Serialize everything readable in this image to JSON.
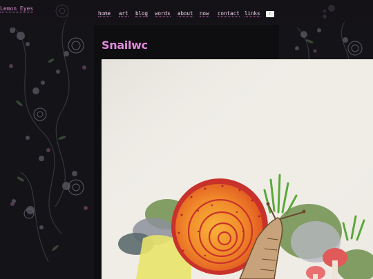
{
  "site": {
    "title": "Lemon Eyes"
  },
  "nav": {
    "items": [
      {
        "label": "home"
      },
      {
        "label": "art"
      },
      {
        "label": "blog"
      },
      {
        "label": "words"
      },
      {
        "label": "about"
      },
      {
        "label": "now"
      },
      {
        "label": "contact"
      },
      {
        "label": "links"
      }
    ],
    "theme_toggle_icon": "moon-icon"
  },
  "page": {
    "title": "Snailwc"
  },
  "artwork": {
    "subject": "watercolor snail with mushrooms and mossy rocks",
    "colors": {
      "paper": "#f1efe9",
      "shell_orange": "#f08a2a",
      "shell_red": "#c8322a",
      "moss_green": "#6f8f4c",
      "rock_grey": "#8c8f9a",
      "mushroom_red": "#e05a5a"
    }
  },
  "theme": {
    "accent": "#e28adf",
    "background": "#141317"
  }
}
